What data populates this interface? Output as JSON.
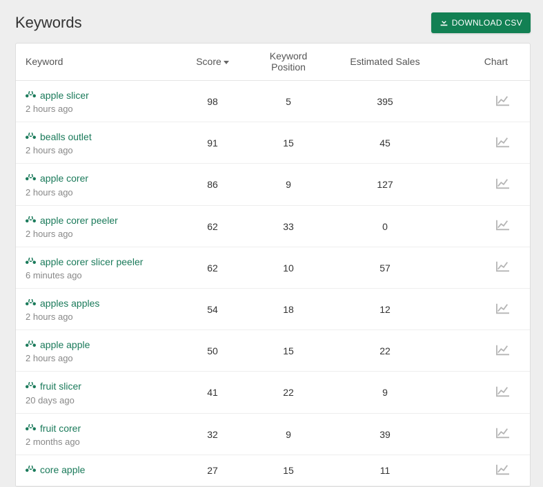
{
  "page_title": "Keywords",
  "download_label": "DOWNLOAD CSV",
  "columns": {
    "keyword": "Keyword",
    "score": "Score",
    "position": "Keyword Position",
    "sales": "Estimated Sales",
    "chart": "Chart"
  },
  "rows": [
    {
      "keyword": "apple slicer",
      "time": "2 hours ago",
      "score": "98",
      "position": "5",
      "sales": "395"
    },
    {
      "keyword": "bealls outlet",
      "time": "2 hours ago",
      "score": "91",
      "position": "15",
      "sales": "45"
    },
    {
      "keyword": "apple corer",
      "time": "2 hours ago",
      "score": "86",
      "position": "9",
      "sales": "127"
    },
    {
      "keyword": "apple corer peeler",
      "time": "2 hours ago",
      "score": "62",
      "position": "33",
      "sales": "0"
    },
    {
      "keyword": "apple corer slicer peeler",
      "time": "6 minutes ago",
      "score": "62",
      "position": "10",
      "sales": "57"
    },
    {
      "keyword": "apples apples",
      "time": "2 hours ago",
      "score": "54",
      "position": "18",
      "sales": "12"
    },
    {
      "keyword": "apple apple",
      "time": "2 hours ago",
      "score": "50",
      "position": "15",
      "sales": "22"
    },
    {
      "keyword": "fruit slicer",
      "time": "20 days ago",
      "score": "41",
      "position": "22",
      "sales": "9"
    },
    {
      "keyword": "fruit corer",
      "time": "2 months ago",
      "score": "32",
      "position": "9",
      "sales": "39"
    },
    {
      "keyword": "core apple",
      "time": "",
      "score": "27",
      "position": "15",
      "sales": "11"
    }
  ]
}
